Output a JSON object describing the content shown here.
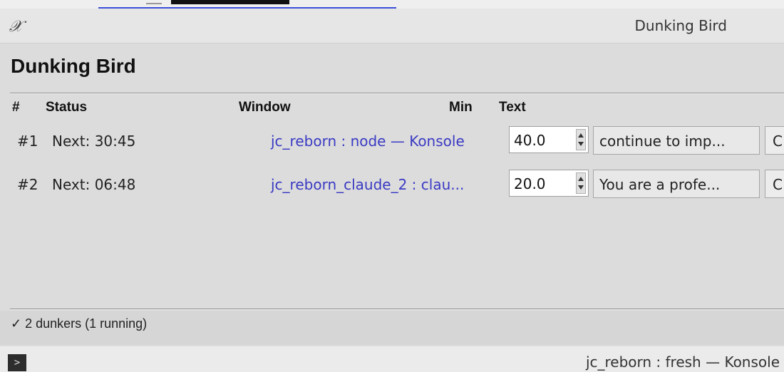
{
  "window": {
    "title": "Dunking Bird",
    "app_icon_glyph": "𝒳"
  },
  "app": {
    "heading": "Dunking Bird",
    "columns": {
      "num": "#",
      "status": "Status",
      "window": "Window",
      "min": "Min",
      "text": "Text"
    },
    "rows": [
      {
        "num": "#1",
        "status": "Next: 30:45",
        "window": "jc_reborn : node — Konsole",
        "min": "40.0",
        "text": "continue to imp...",
        "button_partial": "C"
      },
      {
        "num": "#2",
        "status": "Next: 06:48",
        "window": "jc_reborn_claude_2 : clau...",
        "min": "20.0",
        "text": "You are a profe...",
        "button_partial": "C"
      }
    ],
    "status_bar": "✓ 2 dunkers (1 running)"
  },
  "bottom_window": {
    "title": "jc_reborn : fresh — Konsole",
    "icon_glyph": ">"
  },
  "colors": {
    "link": "#3a3ac4",
    "background": "#dcdcdc"
  }
}
